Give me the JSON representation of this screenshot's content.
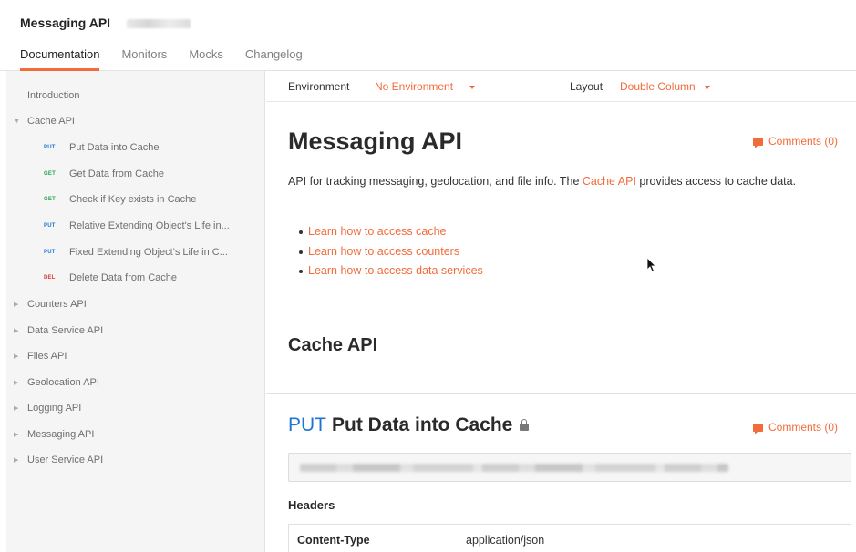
{
  "header": {
    "title": "Messaging API",
    "tabs": [
      {
        "label": "Documentation"
      },
      {
        "label": "Monitors"
      },
      {
        "label": "Mocks"
      },
      {
        "label": "Changelog"
      }
    ]
  },
  "sidebar": {
    "introduction": "Introduction",
    "cache_api": "Cache API",
    "cache_items": [
      {
        "method": "PUT",
        "label": "Put Data into Cache"
      },
      {
        "method": "GET",
        "label": "Get Data from Cache"
      },
      {
        "method": "GET",
        "label": "Check if Key exists in Cache"
      },
      {
        "method": "PUT",
        "label": "Relative Extending Object's Life in..."
      },
      {
        "method": "PUT",
        "label": "Fixed Extending Object's Life in C..."
      },
      {
        "method": "DEL",
        "label": "Delete Data from Cache"
      }
    ],
    "groups": [
      {
        "label": "Counters API"
      },
      {
        "label": "Data Service API"
      },
      {
        "label": "Files API"
      },
      {
        "label": "Geolocation API"
      },
      {
        "label": "Logging API"
      },
      {
        "label": "Messaging API"
      },
      {
        "label": "User Service API"
      }
    ]
  },
  "envbar": {
    "environment_label": "Environment",
    "environment_value": "No Environment",
    "layout_label": "Layout",
    "layout_value": "Double Column"
  },
  "main": {
    "title": "Messaging API",
    "comments": "Comments (0)",
    "desc_pre": "API for tracking messaging, geolocation, and file info. The ",
    "desc_link": "Cache API",
    "desc_post": " provides access to cache data.",
    "links": [
      {
        "label": "Learn how to access cache"
      },
      {
        "label": "Learn how to access counters"
      },
      {
        "label": "Learn how to access data services"
      }
    ],
    "section_title": "Cache API",
    "endpoint": {
      "method": "PUT",
      "name": "Put Data into Cache",
      "comments": "Comments (0)",
      "headers_label": "Headers",
      "header_key": "Content-Type",
      "header_value": "application/json"
    }
  },
  "colors": {
    "accent": "#f26b3a",
    "put": "#1f76d2",
    "get": "#26a54f",
    "del": "#d83b3b"
  }
}
